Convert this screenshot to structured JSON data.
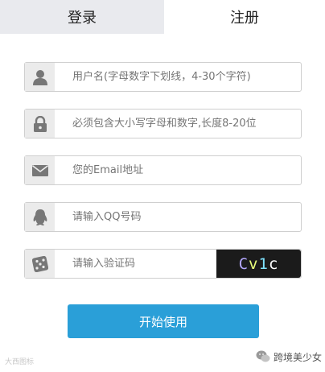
{
  "tabs": {
    "login": "登录",
    "register": "注册"
  },
  "form": {
    "username_placeholder": "用户名(字母数字下划线，4-30个字符)",
    "password_placeholder": "必须包含大小写字母和数字,长度8-20位",
    "email_placeholder": "您的Email地址",
    "qq_placeholder": "请输入QQ号码",
    "captcha_placeholder": "请输入验证码",
    "captcha_text": [
      "C",
      "v",
      "1",
      "c"
    ],
    "submit_label": "开始使用"
  },
  "icons": {
    "username": "user-icon",
    "password": "lock-icon",
    "email": "envelope-icon",
    "qq": "qq-penguin-icon",
    "captcha": "dice-icon"
  },
  "watermark": {
    "left": "大西图标",
    "right": "跨境美少女"
  },
  "colors": {
    "accent": "#2a9fd8",
    "captcha_bg": "#1b1b1b"
  }
}
